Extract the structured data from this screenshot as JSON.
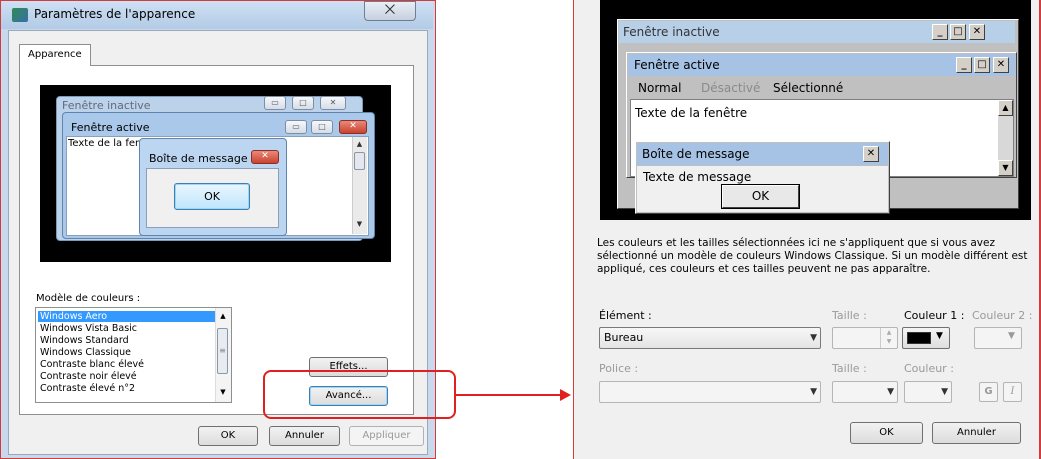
{
  "left_dialog": {
    "title": "Paramètres de l'apparence",
    "close_glyph": "⨉",
    "tab": "Apparence",
    "preview": {
      "inactive_title": "Fenêtre inactive",
      "active_title": "Fenêtre active",
      "window_text": "Texte de la fenêtre",
      "message_title": "Boîte de message",
      "ok": "OK"
    },
    "scheme_label": "Modèle de couleurs :",
    "schemes": [
      "Windows Aero",
      "Windows Vista Basic",
      "Windows Standard",
      "Windows Classique",
      "Contraste blanc élevé",
      "Contraste noir élevé",
      "Contraste élevé n°2"
    ],
    "selected_scheme": "Windows Aero",
    "buttons": {
      "effets": "Effets...",
      "avance": "Avancé...",
      "ok": "OK",
      "annuler": "Annuler",
      "appliquer": "Appliquer"
    }
  },
  "right_dialog": {
    "preview": {
      "inactive_title": "Fenêtre inactive",
      "active_title": "Fenêtre active",
      "menu_normal": "Normal",
      "menu_disabled": "Désactivé",
      "menu_selected": "Sélectionné",
      "window_text": "Texte de la fenêtre",
      "message_title": "Boîte de message",
      "message_text": "Texte de message",
      "ok": "OK"
    },
    "info": "Les couleurs et les tailles sélectionnées ici ne s'appliquent que si vous avez sélectionné un modèle de couleurs Windows Classique. Si un modèle différent est appliqué, ces couleurs et ces tailles peuvent ne pas apparaître.",
    "labels": {
      "element": "Élément :",
      "taille1": "Taille :",
      "couleur1": "Couleur 1 :",
      "couleur2": "Couleur 2 :",
      "police": "Police :",
      "taille2": "Taille :",
      "couleur3": "Couleur :"
    },
    "element_value": "Bureau",
    "color1": "#000000",
    "bold_label": "G",
    "italic_label": "I",
    "buttons": {
      "ok": "OK",
      "annuler": "Annuler"
    }
  },
  "colors": {
    "annotation_red": "#e02020",
    "selection_blue": "#3399ff"
  }
}
